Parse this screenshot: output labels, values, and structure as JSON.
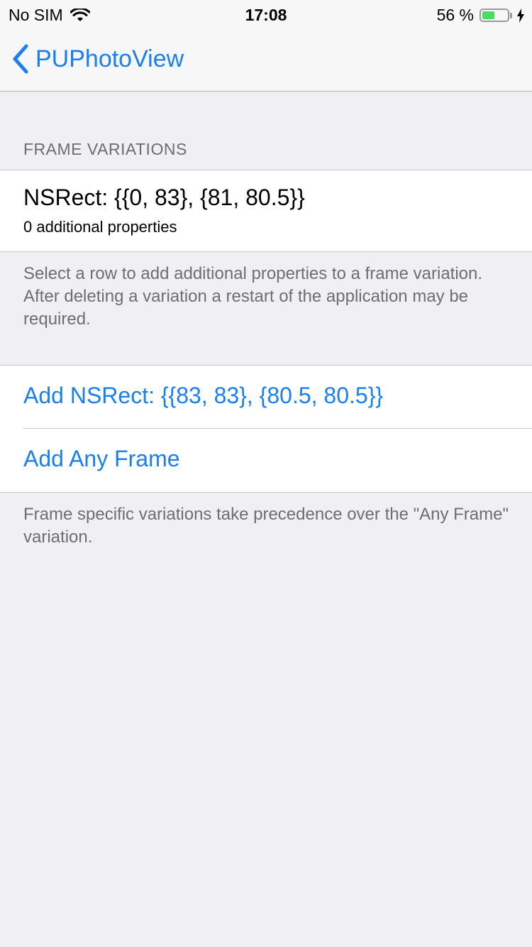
{
  "status_bar": {
    "carrier": "No SIM",
    "time": "17:08",
    "battery_percent": "56 %",
    "battery_level": 0.56,
    "wifi_icon": "wifi-icon",
    "charging_icon": "bolt-icon"
  },
  "nav": {
    "back_label": "PUPhotoView",
    "back_icon": "chevron-left-icon",
    "accent_color": "#1a7ff0"
  },
  "frame_variations": {
    "header": "FRAME VARIATIONS",
    "items": [
      {
        "title": "NSRect: {{0, 83}, {81, 80.5}}",
        "subtitle": "0 additional properties"
      }
    ],
    "footer": "Select a row to add additional properties to a frame variation. After deleting a variation a restart of the application may be required."
  },
  "actions": {
    "items": [
      {
        "label": "Add NSRect: {{83, 83}, {80.5, 80.5}}"
      },
      {
        "label": "Add Any Frame"
      }
    ],
    "footer": "Frame specific variations take precedence over the \"Any Frame\" variation."
  }
}
